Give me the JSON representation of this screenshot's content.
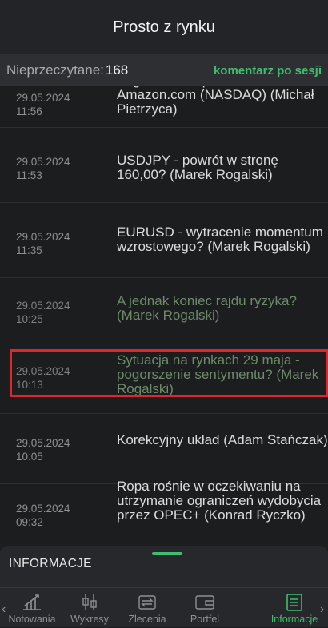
{
  "header": {
    "title": "Prosto z rynku"
  },
  "unread": {
    "label": "Nieprzeczytane:",
    "count": "168",
    "session_link": "komentarz po sesji"
  },
  "items": [
    {
      "date": "29.05.2024",
      "time": "11:56",
      "headline": "Zagraniczna spółka dnia- Amazon.com (NASDAQ) (Michał Pietrzyca)",
      "read": false
    },
    {
      "date": "29.05.2024",
      "time": "11:53",
      "headline": "USDJPY - powrót w stronę 160,00? (Marek Rogalski)",
      "read": false
    },
    {
      "date": "29.05.2024",
      "time": "11:35",
      "headline": "EURUSD - wytracenie momentum wzrostowego? (Marek Rogalski)",
      "read": false
    },
    {
      "date": "29.05.2024",
      "time": "10:25",
      "headline": "A jednak koniec rajdu ryzyka? (Marek Rogalski)",
      "read": true
    },
    {
      "date": "29.05.2024",
      "time": "10:13",
      "headline": "Sytuacja na rynkach 29 maja - pogorszenie sentymentu? (Marek Rogalski)",
      "read": true
    },
    {
      "date": "29.05.2024",
      "time": "10:05",
      "headline": "Korekcyjny układ (Adam Stańczak)",
      "read": false
    },
    {
      "date": "29.05.2024",
      "time": "09:32",
      "headline": "Ropa rośnie w oczekiwaniu na utrzymanie ograniczeń wydobycia przez OPEC+ (Konrad Ryczko)",
      "read": false
    }
  ],
  "sheet": {
    "title": "INFORMACJE"
  },
  "tabs": [
    {
      "label": "Notowania",
      "icon": "chart-growth-icon"
    },
    {
      "label": "Wykresy",
      "icon": "candlestick-icon"
    },
    {
      "label": "Zlecenia",
      "icon": "exchange-icon"
    },
    {
      "label": "Portfel",
      "icon": "wallet-icon"
    },
    {
      "label": "Informacje",
      "icon": "news-icon",
      "active": true
    }
  ],
  "colors": {
    "accent": "#3fbf6e",
    "highlight": "#e0262b",
    "read_headline": "#6d8b69"
  }
}
